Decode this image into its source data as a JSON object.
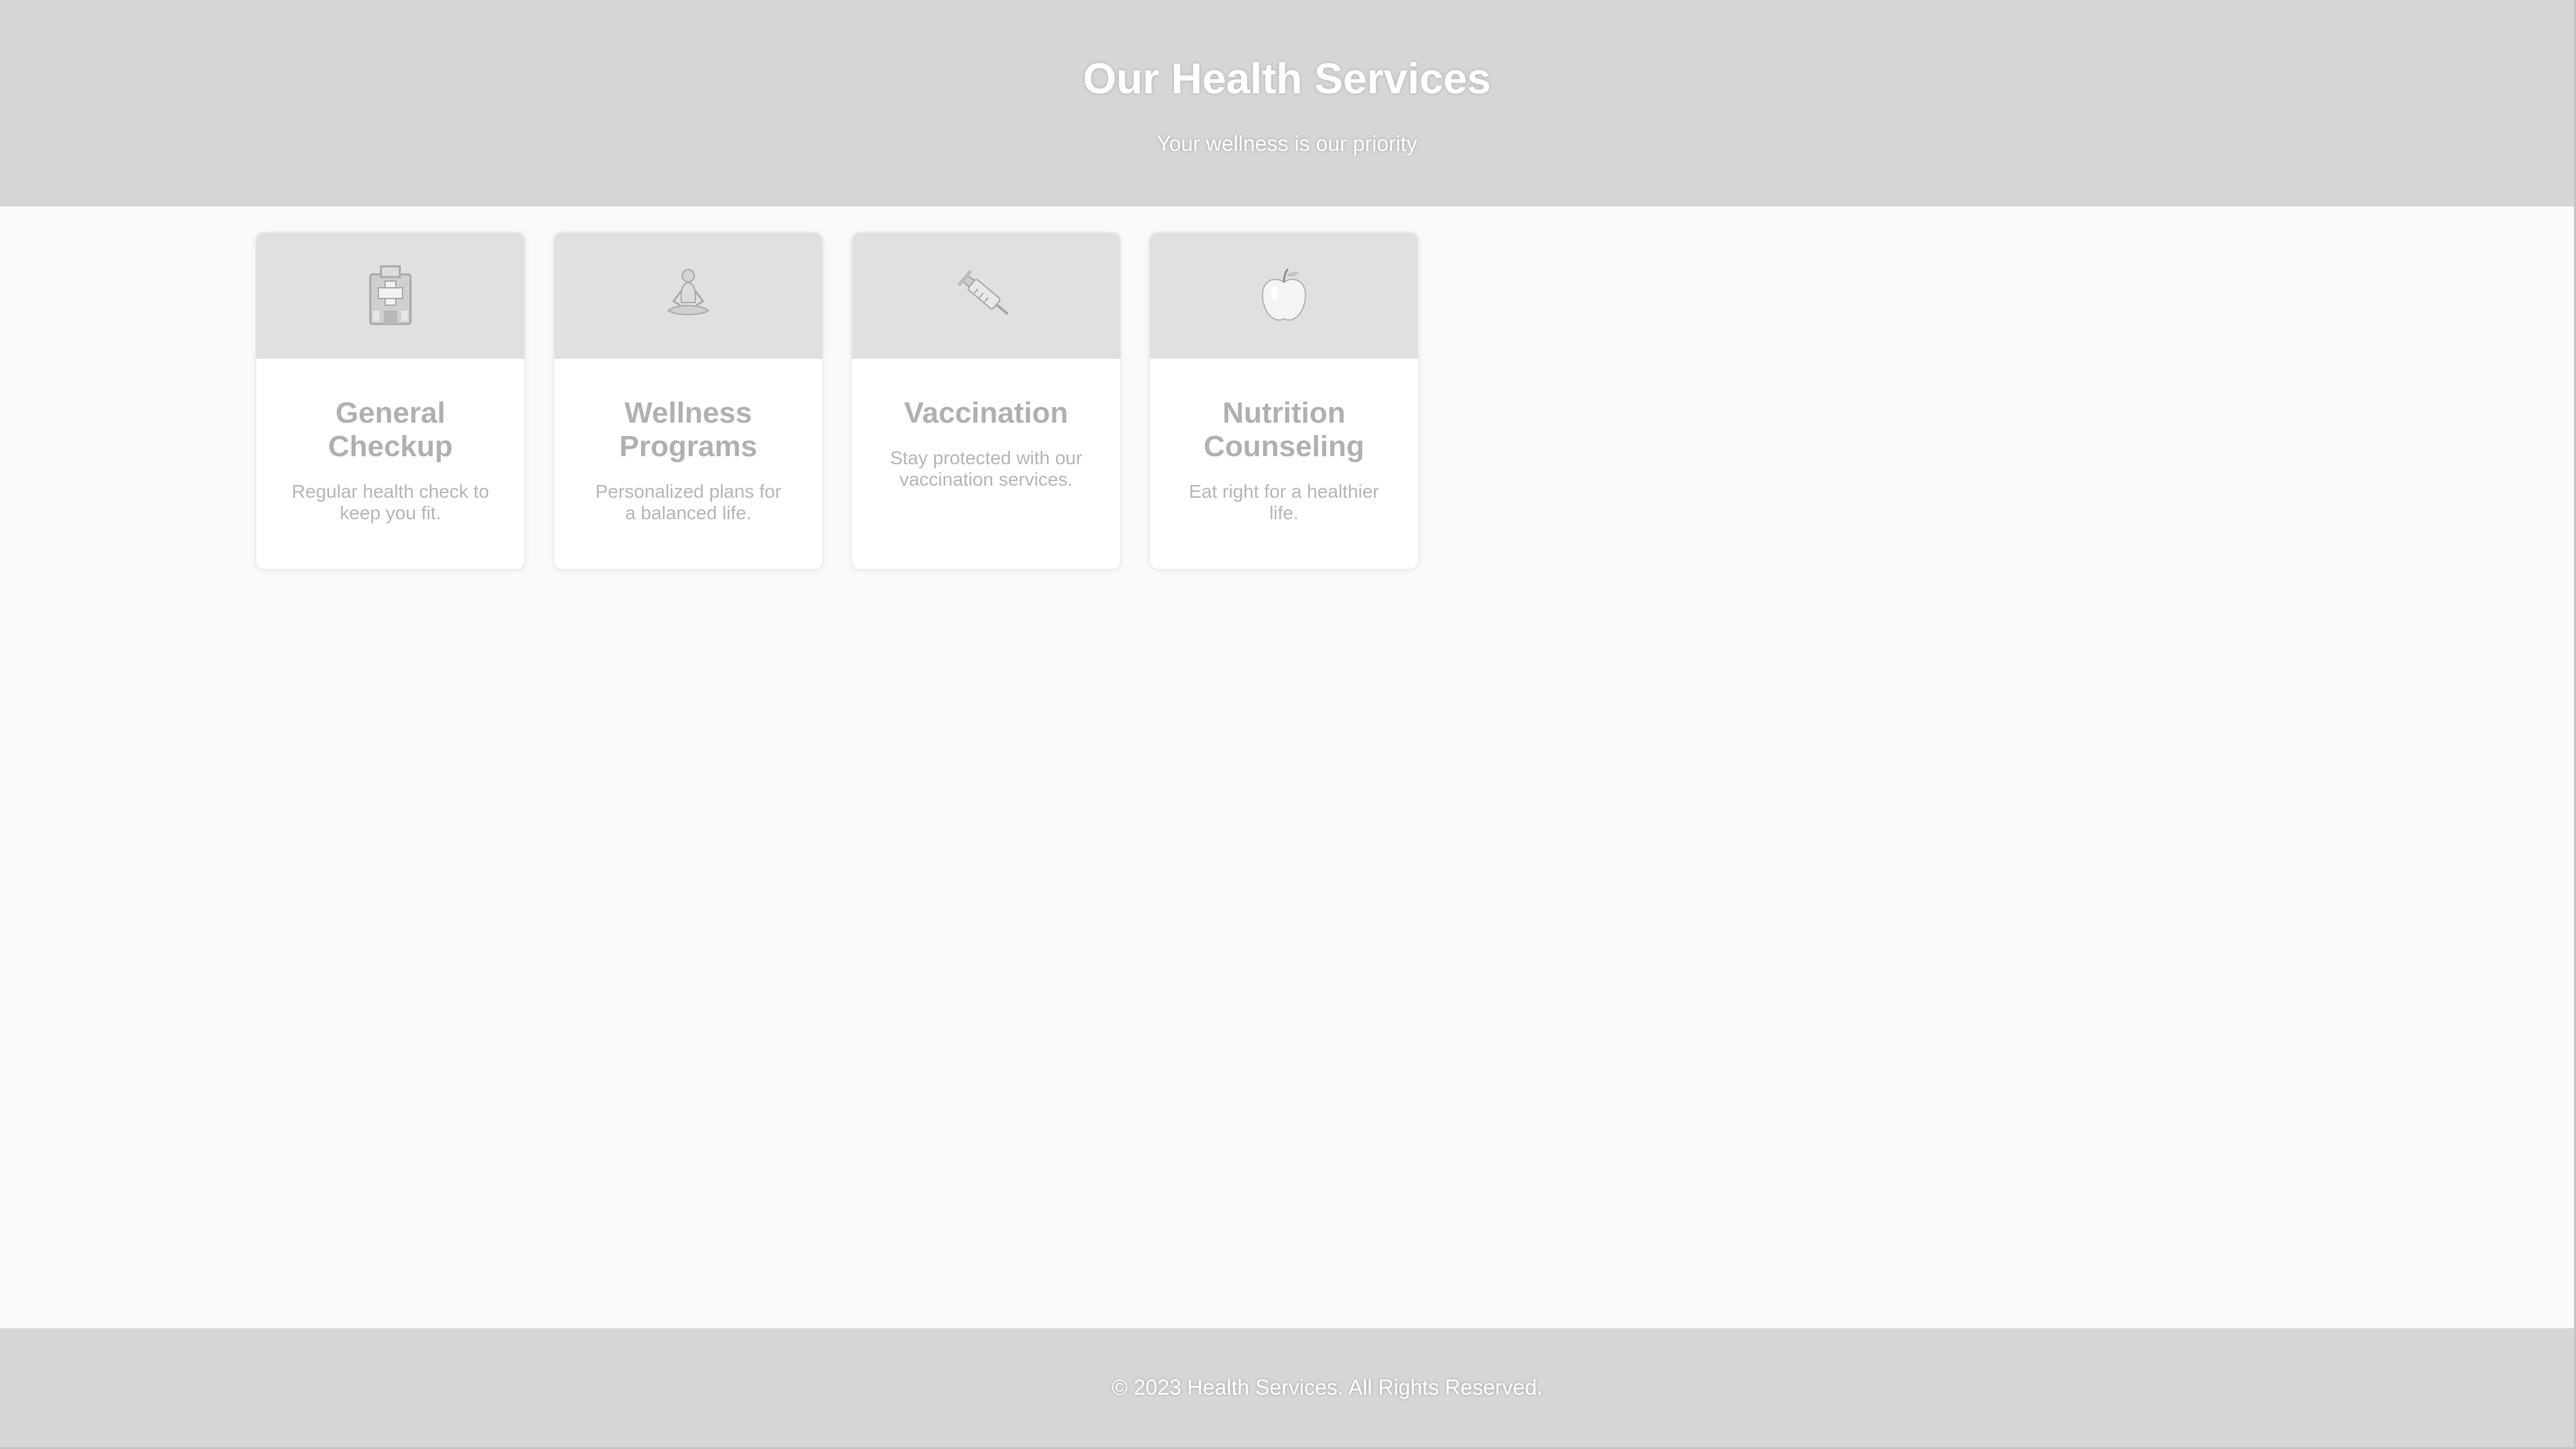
{
  "header": {
    "title": "Our Health Services",
    "subtitle": "Your wellness is our priority"
  },
  "services": [
    {
      "icon": "hospital-icon",
      "title": "General Checkup",
      "description": "Regular health check to keep you fit."
    },
    {
      "icon": "meditation-icon",
      "title": "Wellness Programs",
      "description": "Personalized plans for a balanced life."
    },
    {
      "icon": "syringe-icon",
      "title": "Vaccination",
      "description": "Stay protected with our vaccination services."
    },
    {
      "icon": "apple-icon",
      "title": "Nutrition Counseling",
      "description": "Eat right for a healthier life."
    }
  ],
  "footer": {
    "text": "© 2023 Health Services. All Rights Reserved."
  },
  "colors": {
    "header_bg": "#d6d6d6",
    "card_top_bg": "#e0e0e0",
    "page_bg": "#fafafa",
    "heading_text": "#b0b0b0"
  }
}
